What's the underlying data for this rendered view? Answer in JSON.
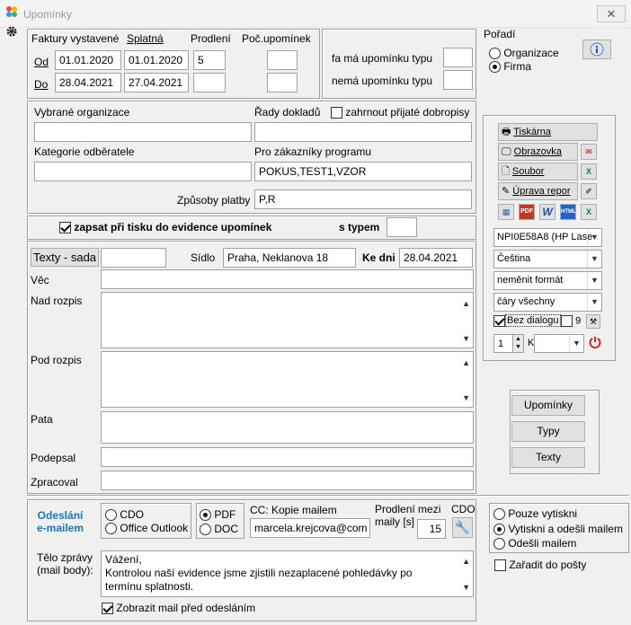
{
  "window": {
    "title": "Upomínky",
    "close": "✕"
  },
  "invoices": {
    "col_issued": "Faktury vystavené",
    "col_due": "Splatná",
    "col_extension": "Prodlení",
    "col_reminders": "Poč.upomínek",
    "row_from": "Od",
    "row_to": "Do",
    "from_issued": "01.01.2020",
    "from_due": "01.01.2020",
    "from_extension": "5",
    "from_reminders": "",
    "to_issued": "28.04.2021",
    "to_due": "27.04.2021",
    "to_extension": "",
    "to_reminders": ""
  },
  "reminder_type": {
    "has_label": "fa má upomínku typu",
    "has_value": "",
    "not_label": "nemá upomínku typu",
    "not_value": ""
  },
  "order": {
    "label": "Pořadí",
    "opt_org": "Organizace",
    "opt_firm": "Firma",
    "selected": "firm"
  },
  "filters": {
    "orgs_label": "Vybrané organizace",
    "orgs_value": "",
    "series_label": "Řady dokladů",
    "include_credit_label": "zahrnout přijaté dobropisy",
    "series_value": "",
    "category_label": "Kategorie odběratele",
    "category_value": "",
    "program_label": "Pro zákazníky programu",
    "program_value": "POKUS,TEST1,VZOR",
    "payment_label": "Způsoby platby",
    "payment_value": "P,R"
  },
  "record": {
    "label": "zapsat při tisku do evidence upomínek",
    "type_label": "s typem",
    "type_value": ""
  },
  "texts": {
    "set_label": "Texty - sada",
    "set_value": "",
    "seat_label": "Sídlo",
    "seat_value": "Praha, Neklanova 18",
    "date_label": "Ke dni",
    "date_value": "28.04.2021",
    "subject_label": "Věc",
    "subject_value": "",
    "above_label": "Nad rozpis",
    "above_value": "",
    "below_label": "Pod rozpis",
    "below_value": "",
    "footer_label": "Pata",
    "footer_value": "",
    "signed_label": "Podepsal",
    "signed_value": "",
    "processed_label": "Zpracoval",
    "processed_value": ""
  },
  "output": {
    "printer": "Tiskárna",
    "screen": "Obrazovka",
    "file": "Soubor",
    "edit_report": "Úprava repor",
    "printer_select": "NPI0E58A8 (HP Lase",
    "language_select": "Čeština",
    "format_select": "neměnit formát",
    "lines_select": "čáry všechny",
    "no_dialog_label": "Bez dialogu",
    "copies_extra": "9",
    "copies_value": "1",
    "copies_suffix": "K",
    "pdf_label": "PDF",
    "word_label": "W",
    "html_label": "HTML"
  },
  "actions": {
    "reminders": "Upomínky",
    "types": "Typy",
    "texts": "Texty"
  },
  "email": {
    "section_label_1": "Odeslání",
    "section_label_2": "e-mailem",
    "cdo": "CDO",
    "outlook": "Office Outlook",
    "pdf": "PDF",
    "doc": "DOC",
    "cc_label": "CC: Kopie mailem",
    "cc_value": "marcela.krejcova@com",
    "delay_label_1": "Prodlení mezi",
    "delay_label_2": "maily [s]",
    "delay_value": "15",
    "cdo_label": "CDO",
    "body_label_1": "Tělo zprávy",
    "body_label_2": "(mail body):",
    "body_line_1": "Vážení,",
    "body_line_2": "Kontrolou naší evidence jsme zjistili nezaplacené pohledávky po",
    "body_line_3": "termínu splatnosti.",
    "show_before_label": "Zobrazit mail před odesláním"
  },
  "send_mode": {
    "print_only": "Pouze vytiskni",
    "print_send": "Vytiskni a odešli mailem",
    "send_only": "Odešli mailem",
    "to_mail": "Zařadit do pošty"
  }
}
